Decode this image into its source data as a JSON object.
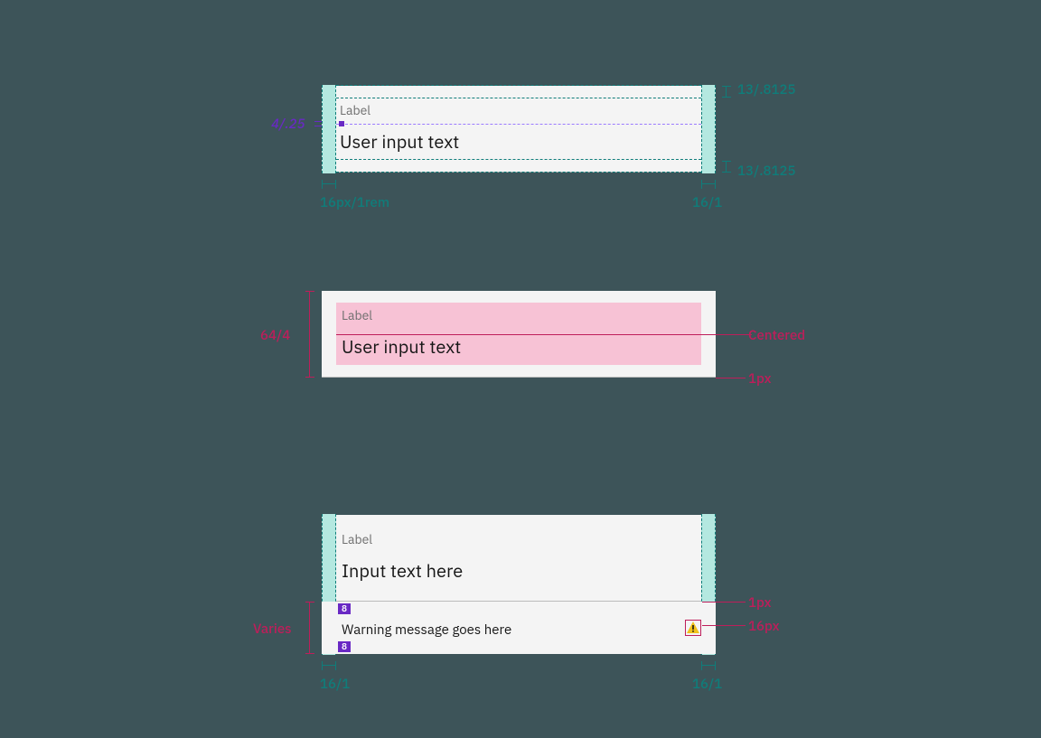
{
  "exhibits": {
    "top": {
      "label": "Label",
      "input": "User input text",
      "annotations": {
        "gap_vertical": "4/.25",
        "padding_top": "13/.8125",
        "padding_bottom": "13/.8125",
        "padding_left": "16px/1rem",
        "padding_right": "16/1"
      }
    },
    "middle": {
      "label": "Label",
      "input": "User input text",
      "annotations": {
        "height": "64/4",
        "alignment": "Centered",
        "border": "1px"
      }
    },
    "bottom": {
      "label": "Label",
      "input": "Input text here",
      "message": "Warning message goes here",
      "spacing_badge": "8",
      "annotations": {
        "message_height": "Varies",
        "padding_left": "16/1",
        "padding_right": "16/1",
        "divider": "1px",
        "icon_size": "16px"
      }
    }
  },
  "colors": {
    "teal": "#0f7d7a",
    "magenta": "#be1e5a",
    "purple": "#6929c4",
    "mint": "#b4e8e0",
    "pink": "#f7c2d5",
    "field": "#f4f4f4"
  }
}
